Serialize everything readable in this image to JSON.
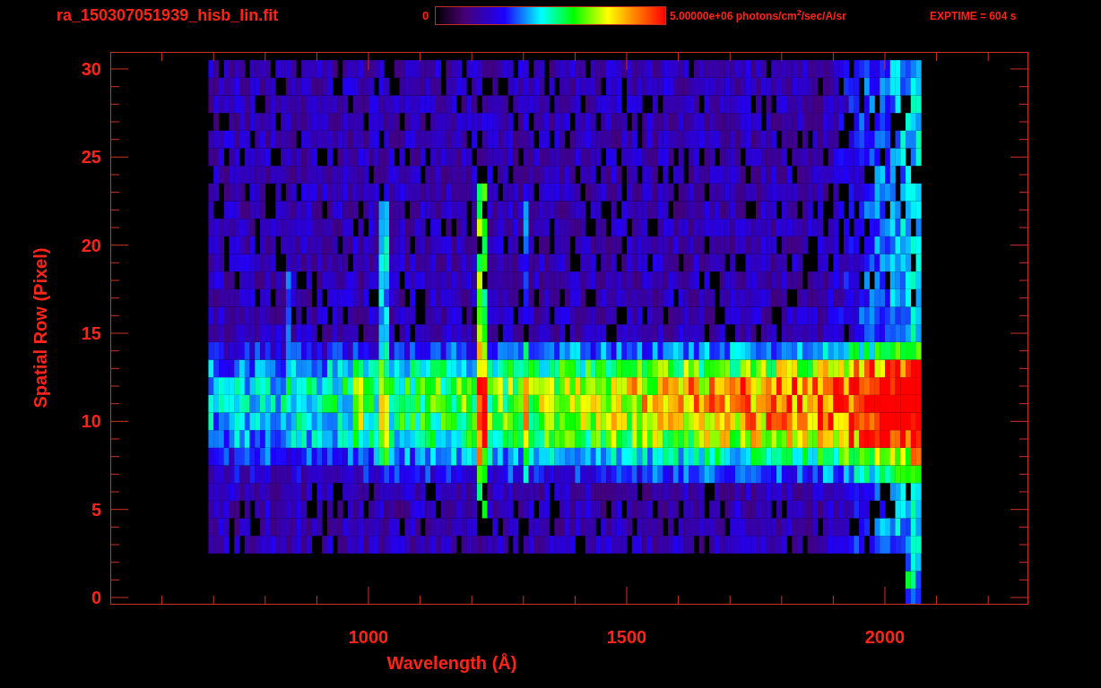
{
  "title": "ra_150307051939_hisb_lin.fit",
  "colorbar": {
    "min_label": "0",
    "max_label": "5.00000e+06 photons/cm$^{2}$/sec/A/sr"
  },
  "exposure": "EXPTIME = 604 s",
  "plot": {
    "ylabel": "Spatial Row (Pixel)",
    "xlabel": "Wavelength (Å)",
    "yticks": [
      "30",
      "25",
      "20",
      "15",
      "10",
      "5",
      "0"
    ],
    "xticks": [
      "1000",
      "1500",
      "2000"
    ]
  }
}
